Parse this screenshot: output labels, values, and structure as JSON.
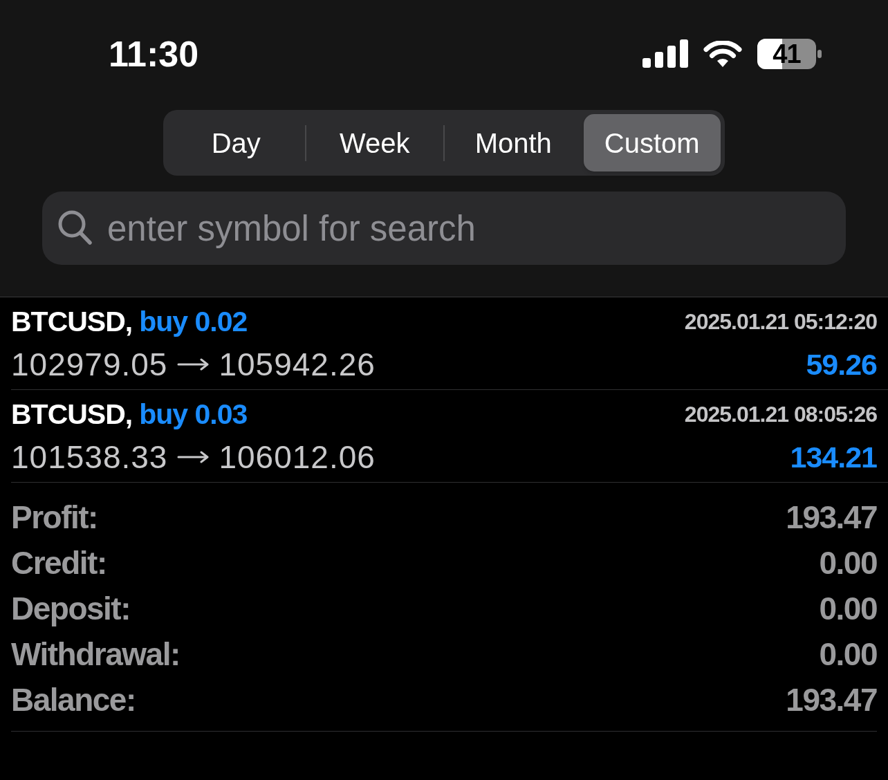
{
  "status_bar": {
    "time": "11:30",
    "battery": "41"
  },
  "period_tabs": [
    {
      "label": "Day",
      "selected": false
    },
    {
      "label": "Week",
      "selected": false
    },
    {
      "label": "Month",
      "selected": false
    },
    {
      "label": "Custom",
      "selected": true
    }
  ],
  "search": {
    "placeholder": "enter symbol for search"
  },
  "trades": [
    {
      "symbol": "BTCUSD,",
      "side": "buy 0.02",
      "time": "2025.01.21 05:12:20",
      "open_price": "102979.05",
      "close_price": "105942.26",
      "profit": "59.26"
    },
    {
      "symbol": "BTCUSD,",
      "side": "buy 0.03",
      "time": "2025.01.21 08:05:26",
      "open_price": "101538.33",
      "close_price": "106012.06",
      "profit": "134.21"
    }
  ],
  "summary": [
    {
      "label": "Profit:",
      "value": "193.47"
    },
    {
      "label": "Credit:",
      "value": "0.00"
    },
    {
      "label": "Deposit:",
      "value": "0.00"
    },
    {
      "label": "Withdrawal:",
      "value": "0.00"
    },
    {
      "label": "Balance:",
      "value": "193.47"
    }
  ]
}
